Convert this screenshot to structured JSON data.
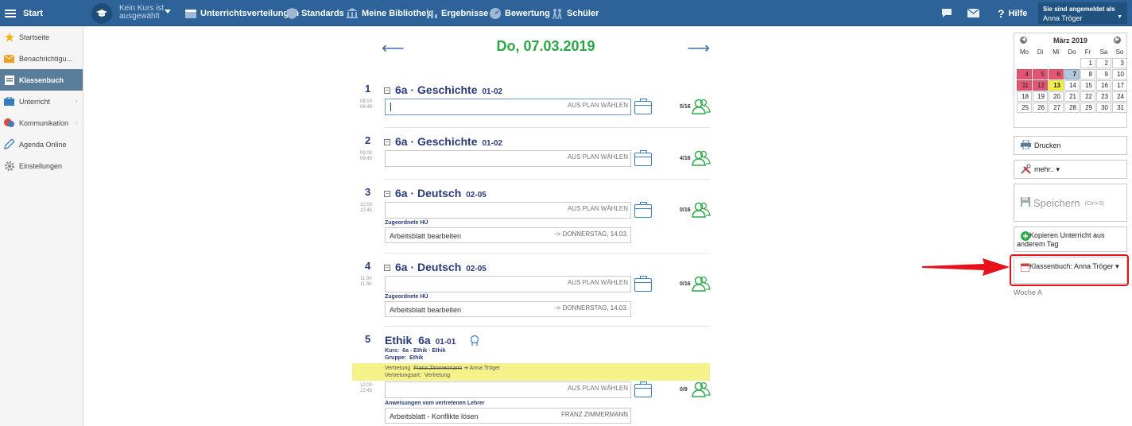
{
  "topbar": {
    "start_label": "Start",
    "course_line1": "Kein Kurs ist",
    "course_line2": "ausgewählt",
    "nav": [
      {
        "label": "Unterrichtsverteilungen"
      },
      {
        "label": "Standards"
      },
      {
        "label": "Meine Bibliothek"
      },
      {
        "label": "Ergebnisse"
      },
      {
        "label": "Bewertung"
      },
      {
        "label": "Schüler"
      }
    ],
    "help_label": "Hilfe",
    "user_caption": "Sie sind angemeldet als",
    "user_name": "Anna Tröger"
  },
  "sidebar": {
    "items": [
      {
        "label": "Startseite",
        "icon": "star-icon"
      },
      {
        "label": "Benachrichtigu...",
        "icon": "envelope-icon"
      },
      {
        "label": "Klassenbuch",
        "icon": "classbook-icon",
        "active": true
      },
      {
        "label": "Unterricht",
        "icon": "briefcase-icon"
      },
      {
        "label": "Kommunikation",
        "icon": "chat-icon"
      },
      {
        "label": "Agenda Online",
        "icon": "pencil-icon"
      },
      {
        "label": "Einstellungen",
        "icon": "gear-icon"
      }
    ]
  },
  "date_title": "Do, 07.03.2019",
  "lessons": [
    {
      "num": "1",
      "time_start": "08:00",
      "time_end": "08:45",
      "subject": "6a · Geschichte",
      "code": "01-02",
      "plan": "AUS PLAN WÄHLEN",
      "count": "5/16"
    },
    {
      "num": "2",
      "time_start": "09:00",
      "time_end": "09:45",
      "subject": "6a · Geschichte",
      "code": "01-02",
      "plan": "AUS PLAN WÄHLEN",
      "count": "4/16"
    },
    {
      "num": "3",
      "time_start": "10:00",
      "time_end": "10:45",
      "subject": "6a · Deutsch",
      "code": "02-05",
      "plan": "AUS PLAN WÄHLEN",
      "count": "0/16",
      "hw_label": "Zugeordnete HÜ",
      "hw_text": "Arbeitsblatt bearbeiten",
      "hw_due": "-> DONNERSTAG, 14.03."
    },
    {
      "num": "4",
      "time_start": "11:00",
      "time_end": "11:45",
      "subject": "6a · Deutsch",
      "code": "02-05",
      "plan": "AUS PLAN WÄHLEN",
      "count": "0/16",
      "hw_label": "Zugeordnete HÜ",
      "hw_text": "Arbeitsblatt bearbeiten",
      "hw_due": "-> DONNERSTAG, 14.03."
    }
  ],
  "lesson5": {
    "num": "5",
    "subject": "Ethik",
    "class": "6a",
    "code": "01-01",
    "kurs_label": "Kurs:",
    "kurs_value": "6a - Ethik · Ethik",
    "gruppe_label": "Gruppe:",
    "gruppe_value": "Ethik",
    "vertretung_label": "Vertretung",
    "vertretung_old": "Franz Zimmermann",
    "vertretung_arrow": "➔",
    "vertretung_new": "Anna Tröger",
    "vertretungsart_label": "Vertretungsart:",
    "vertretungsart_value": "Vertretung",
    "time_start": "12:00",
    "time_end": "12:45",
    "plan": "AUS PLAN WÄHLEN",
    "count": "0/9",
    "instr_label": "Anweisungen vom vertretenen Lehrer",
    "instr_text": "Arbeitsblatt - Konflikte lösen",
    "instr_teacher": "FRANZ ZIMMERMANN"
  },
  "calendar": {
    "month": "März 2019",
    "days_header": [
      "Mo",
      "Di",
      "Mi",
      "Do",
      "Fr",
      "Sa",
      "So"
    ],
    "weeks": [
      [
        "",
        "",
        "",
        "",
        "1",
        "2",
        "3"
      ],
      [
        "4",
        "5",
        "6",
        "7",
        "8",
        "9",
        "10"
      ],
      [
        "11",
        "12",
        "13",
        "14",
        "15",
        "16",
        "17"
      ],
      [
        "18",
        "19",
        "20",
        "21",
        "22",
        "23",
        "24"
      ],
      [
        "25",
        "26",
        "27",
        "28",
        "29",
        "30",
        "31"
      ]
    ],
    "red_days": [
      "4",
      "5",
      "6",
      "11",
      "12"
    ],
    "yellow_days": [
      "13"
    ],
    "selected_day": "7"
  },
  "panel": {
    "print_label": "Drucken",
    "more_label": "mehr.. ▾",
    "save_label": "Speichern",
    "save_shortcut": "(Ctrl+S)",
    "copy_label": "Kopieren Unterricht aus anderem Tag",
    "classbook_label": "Klassenbuch: Anna Tröger ▾",
    "woche_label": "Woche A"
  },
  "colors": {
    "topbar": "#2e6399",
    "accent_green": "#27a844",
    "subject_blue": "#2a3a7a",
    "highlight_red": "#e8101a"
  }
}
